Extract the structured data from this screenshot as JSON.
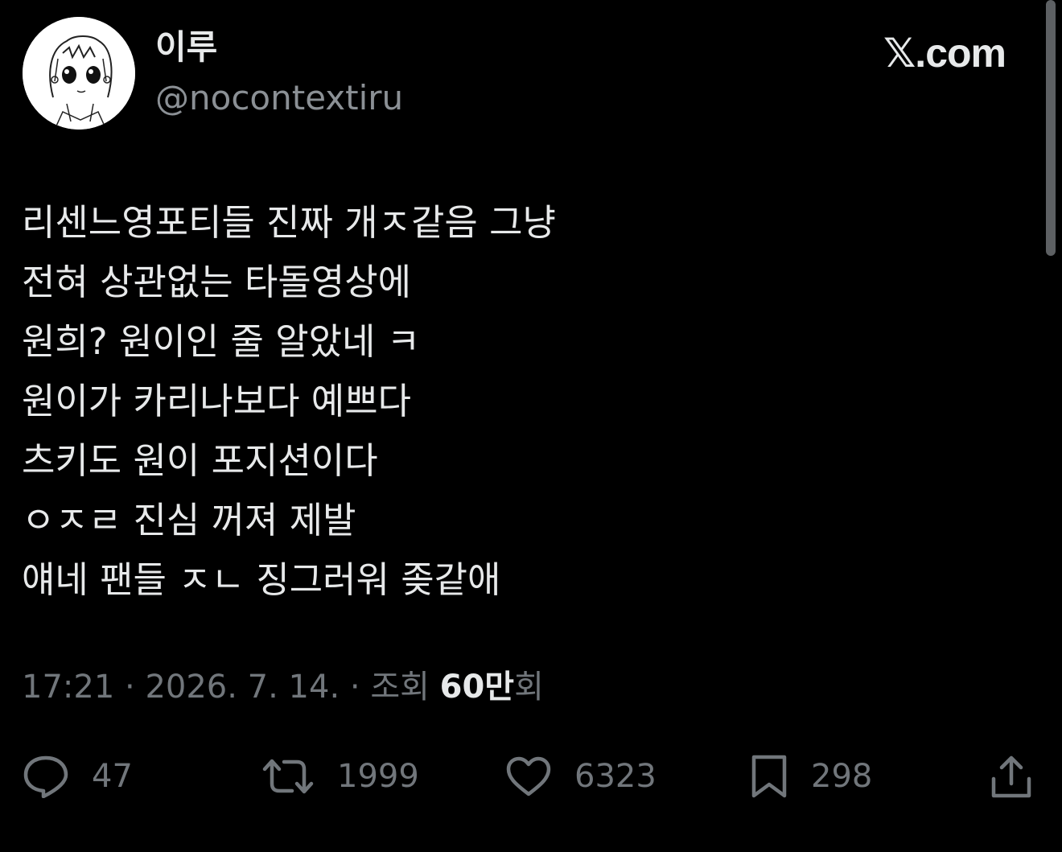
{
  "user": {
    "display_name": "이루",
    "handle": "@nocontextiru",
    "avatar_icon": "cartoon-avatar"
  },
  "brand": {
    "logo_glyph": "𝕏",
    "logo_text": ".com"
  },
  "tweet": {
    "lines": [
      "리센느영포티들 진짜 개ㅈ같음 그냥",
      "전혀 상관없는 타돌영상에",
      "원희? 원이인 줄 알았네 ㅋ",
      "원이가 카리나보다 예쁘다",
      "츠키도 원이 포지션이다",
      "ㅇㅈㄹ 진심 꺼져 제발",
      "얘네 팬들 ㅈㄴ 징그러워 좆같애"
    ],
    "time": "17:21",
    "separator": " · ",
    "date": "2026. 7. 14.",
    "views_prefix": "조회",
    "views_count": "60만",
    "views_suffix": "회"
  },
  "actions": {
    "reply": {
      "icon": "reply-icon",
      "count": "47"
    },
    "retweet": {
      "icon": "retweet-icon",
      "count": "1999"
    },
    "like": {
      "icon": "heart-icon",
      "count": "6323"
    },
    "bookmark": {
      "icon": "bookmark-icon",
      "count": "298"
    },
    "share": {
      "icon": "share-icon"
    }
  },
  "colors": {
    "background": "#000000",
    "primary_text": "#e7e9ea",
    "secondary_text": "#71767b",
    "handle_text": "#8b9095",
    "scrollbar": "#5d6063"
  }
}
